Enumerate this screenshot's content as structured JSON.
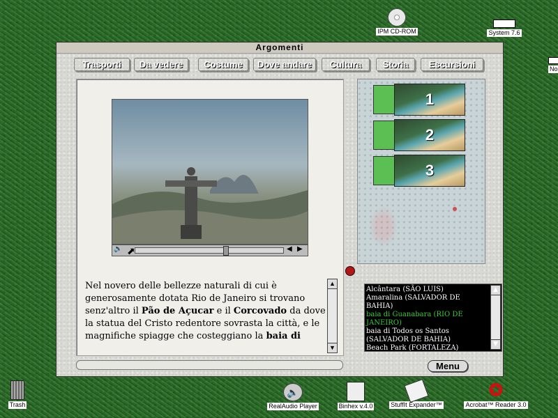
{
  "desktop": {
    "cd_label": "IPM CD-ROM",
    "system_label": "System 7.6",
    "edge_label": "Nor",
    "trash_label": "Trash",
    "apps": [
      "RealAudio Player",
      "Binhex v.4.0",
      "StuffIt Expander™",
      "Acrobat™ Reader 3.0"
    ]
  },
  "window": {
    "title": "Argomenti",
    "tabs": [
      {
        "label": "Trasporti",
        "color": "#d43a3a"
      },
      {
        "label": "Da vedere",
        "color": "#d8d020"
      },
      {
        "label": "Costume",
        "color": "#c8884a"
      },
      {
        "label": "Dove andare",
        "color": "#cc44cc"
      },
      {
        "label": "Cultura",
        "color": "#36b2b8"
      },
      {
        "label": "Storia",
        "color": "#4a52c8"
      },
      {
        "label": "Escursioni",
        "color": "#3aa83a"
      }
    ],
    "text_paragraph": {
      "p1": " Nel novero delle bellezze naturali di cui è generosamente dotata Rio de Janeiro si trovano senz'altro il ",
      "b1": "Pão de Açucar",
      "p2": " e il ",
      "b2": "Corcovado",
      "p3": " da dove la statua del Cristo redentore sovrasta la città, e le magnifiche spiagge che costeggiano la ",
      "b3": "baia di"
    },
    "thumbs": [
      "1",
      "2",
      "3"
    ],
    "list_items": [
      {
        "text": "Alcântara (SÃO LUIS)",
        "color": "#ffffff"
      },
      {
        "text": "Amaralina (SALVADOR DE BAHIA)",
        "color": "#ffffff"
      },
      {
        "text": "baia di Guanabara (RIO DE JANEIRO)",
        "color": "#3cc83c"
      },
      {
        "text": "baia di Todos os Santos (SALVADOR DE BAHIA)",
        "color": "#ffffff"
      },
      {
        "text": "Beach Park (FORTALEZA)",
        "color": "#ffffff"
      }
    ],
    "menu_label": "Menu",
    "video_progress": 0.62
  }
}
